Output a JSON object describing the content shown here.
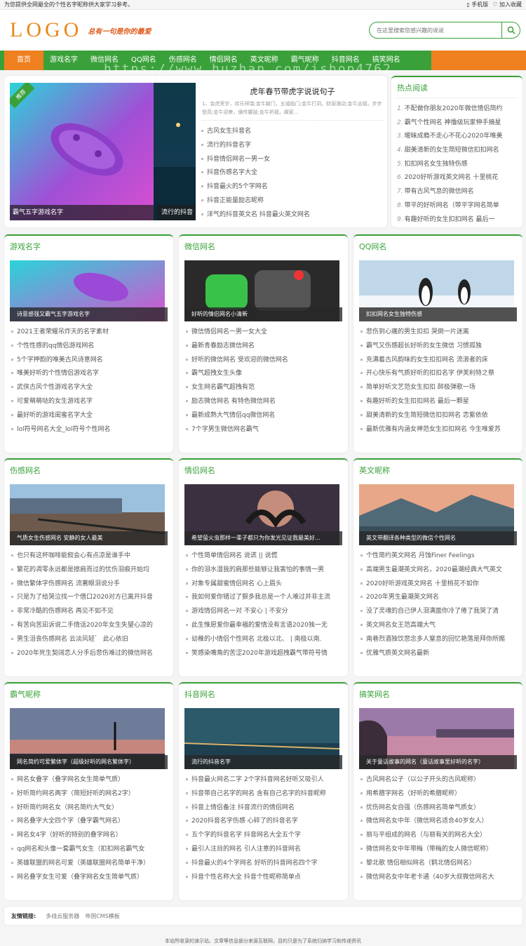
{
  "topbar": {
    "notice": "为您提供全网最全的个性名字昵称供大家学习参考。",
    "mobile": "手机版",
    "favorite": "加入收藏"
  },
  "header": {
    "logo": "LOGO",
    "slogan": "总有一句是你的最爱",
    "search_placeholder": "在这里搜索您感兴趣的说说"
  },
  "nav": {
    "items": [
      "首页",
      "游戏名字",
      "微信网名",
      "QQ网名",
      "伤感网名",
      "情侣网名",
      "英文昵称",
      "霸气昵称",
      "抖音网名",
      "搞笑网名"
    ]
  },
  "watermark": "https://www.huzhan.com/ishop4762",
  "featured": {
    "ribbon": "推荐",
    "caption1": "霸气五字游戏名字",
    "caption2": "流行的抖音",
    "title": "虎年春节带虎字说说句子",
    "desc": "1、金虎贺岁，欢乐祥瑞;金牛献门，五福临门;金牛打洞，财源涌动;金牛运福，步步登高;金牛迎衆，燥传腰鼓;金牛祈福，阖家...",
    "list": [
      "古风女生抖音名",
      "流行的抖音名字",
      "抖音情侣网名一男一女",
      "抖音伤感名字大全",
      "抖音最火的5个字网名",
      "抖音正能量励志昵称",
      "洋气的抖音英文名 抖音最火英文网名"
    ]
  },
  "hot": {
    "title": "热点阅读",
    "items": [
      "不配做你朋友2020年微信情侣简约",
      "霸气个性网名 神撸级玩家伸手摘星",
      "暧昧成瘾不走心不花心2020年唯美",
      "甜美清新的女生简短微信扣扣网名",
      "扣扣网名女生独特伤感",
      "2020好听游戏英文网名 十里桃花",
      "带有古风气息的微信网名",
      "带平的好听网名（带平字网名简单",
      "有趣好听的女生扣扣网名 最后一"
    ]
  },
  "sections": [
    {
      "title": "游戏名字",
      "caption": "诗意感强又霸气五字游戏名字",
      "items": [
        "2021王者荣耀吊炸天的名字素材",
        "个性性感的qq情侣游戏网名",
        "5个字押韵的唯美古风诗意网名",
        "唯美好听的个性情侣游戏名字",
        "武侠古风个性游戏名字大全",
        "可爱萌萌哒的女生游戏名字",
        "最好听的游戏闺蜜名字大全",
        "lol符号网名大全_lol符号个性网名"
      ]
    },
    {
      "title": "微信网名",
      "caption": "好听的情侣网名小清新",
      "items": [
        "微信情侣网名一男一女大全",
        "最新青春励志微信网名",
        "好听的微信网名 受欢迎的微信网名",
        "霸气超拽女生头像",
        "女生网名霸气超拽有范",
        "励志微信网名 有特色微信网名",
        "最新成熟大气情侣qq微信网名",
        "7个字男生微信网名霸气"
      ]
    },
    {
      "title": "QQ网名",
      "caption": "扣扣网名女生独特伤感",
      "items": [
        "悲伤到心痛的男生扣扣 哭倒一片迷离",
        "霸气又伤感超长好听的女生微信 习惯孤独",
        "充满着古风韵味的女生扣扣网名 流浪者的床",
        "开心快乐有气质好听的扣扣名字 伊芙利特之祭",
        "简单好听文艺范女生扣扣 醉极弹歌一场",
        "有趣好听的女生扣扣网名 最后一颗星",
        "甜美清新的女生简短微信扣扣网名 恋紫依依",
        "最新优雅有内涵女神范女生扣扣网名 今生唯爱苏"
      ]
    },
    {
      "title": "伤感网名",
      "caption": "气质女生伤感网名 安静的女人最美",
      "items": [
        "也只有这杯咖啡能叙会心有点凉是谁手中",
        "繁花的凋零永远都是擦肩而过的忧伤泪痕开始均",
        "微信繁体字伤感网名 流著眼泪说分手",
        "只是为了给哭泣找一个借口2020对方已离开抖音",
        "非常冷酷的伤感网名 再见不如不见",
        "有苦向苦凪诉说二手情话2020年女生失望心凉的",
        "男生沮丧伤感网名 云淡风轻゛ 此心依旧",
        "2020年死生契阔恋人分手后悲伤难过的微信网名"
      ]
    },
    {
      "title": "情侣网名",
      "caption": "希望萤火虫那样一辈子都只为你发光见证我最美好...",
      "items": [
        "个性简单情侣网名 说谎 || 说慌",
        "你的泪水湿我的肩那些能够让我害怕的事情一男",
        "对象专属甜蜜情侣网名 心上眉头",
        "我如何爱你错过了狠多我总是一个人难过并非主流",
        "游戏情侣网名一对 不安心 | 不安分",
        "此生惟愿爱你最幸福的爱情没有言语2020独一无",
        "幼稚的小情侣个性网名 北极以北、 | 南极以南.",
        "笑感染嘴角的苦涩2020年游戏超拽霸气带符号情"
      ]
    },
    {
      "title": "英文昵称",
      "caption": "英文带翻译各种类型的微信个性网名",
      "items": [
        "个性简约英文网名 月蚀Finer Feelings",
        "高端男生最潮英文网名，2020最潮经典大气英文",
        "2020好听游戏英文网名 十里桃花不如你",
        "2020年男生最潮英文网名",
        "没了灵魂的自己伊人泪满面你冷了倦了我哭了清",
        "英文网名女王范高端大气",
        "南巷烈酒独饮悲念多人窒息的回忆艳落是拜你所赐",
        "优雅气质英文网名最新"
      ]
    },
    {
      "title": "霸气昵称",
      "caption": "网名简约可爱繁体字（超级好听的网名繁体字）",
      "items": [
        "网名女叠字（叠字网名女生简单气质）",
        "好听简约网名两字（简短好听的网名2字）",
        "好听简约网名女（网名简约大气女）",
        "网名叠字大全四个字（叠字霸气网名）",
        "网名女4字（好听的特别的叠字网名）",
        "qq网名和头像一套霸气女生（扣扣网名霸气女",
        "英雄联盟的网名可爱（英雄联盟网名简单干净）",
        "网名叠字女生可爱（叠字网名女生简单气质）"
      ]
    },
    {
      "title": "抖音网名",
      "caption": "流行的抖音名字",
      "items": [
        "抖音最火网名二字 2个字抖音网名好听又吸引人",
        "抖音带自己名字的网名 含有自己名字的抖音昵称",
        "抖音上情侣备注 抖音流行的情侣网名",
        "2020抖音名字伤感 心碎了的抖音名字",
        "五个字的抖音名字 抖音网名大全五个字",
        "最引人注目的网名 引人注意的抖音网名",
        "抖音最火的4个字网名 好听的抖音网名四个字",
        "抖音个性名称大全 抖音个性昵称简单点"
      ]
    },
    {
      "title": "搞笑网名",
      "caption": "关于童话故事的网名（童话故事里好听的名字）",
      "items": [
        "古风网名公子（以公子开头的古风昵称）",
        "用希腊字网名（好听的希腊昵称）",
        "优伤网名女自强（伤感网名简单气质女）",
        "微信网名女中年（微信网名适合40岁女人）",
        "丽与平组成的网名（与丽有关的网名大全）",
        "微信网名女中年带梅（带梅的女人微信昵称）",
        "黎北歌 情侣相似网名（鹤北情侣网名）",
        "微信网名女中年老卡通（40岁大叔微信网名大"
      ]
    }
  ],
  "friends": {
    "label": "友情链接:",
    "links": [
      "多线云服务器",
      "帝国CMS模板"
    ]
  },
  "footer": "本站所收录的演示站、文章等信息部分来源互联网，目的只是为了系统归纳学习和传递资讯",
  "colors": {
    "primary": "#3aa13a",
    "accent": "#ef8020"
  }
}
